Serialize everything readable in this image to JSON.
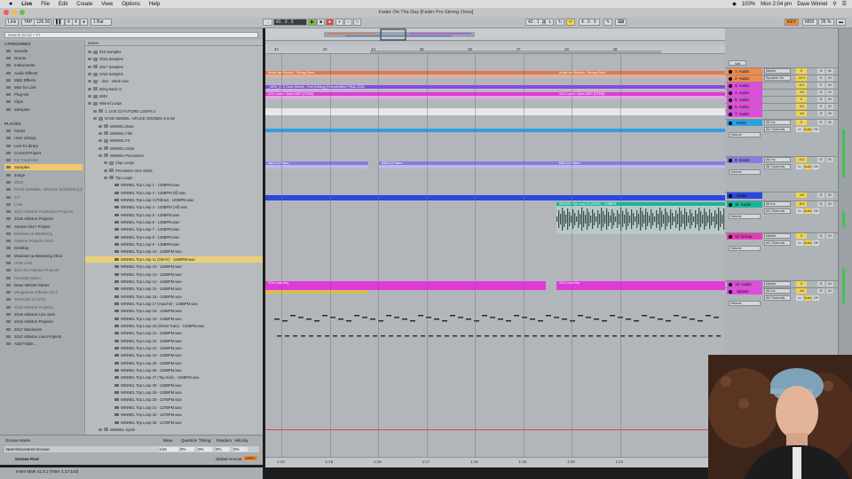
{
  "menubar": {
    "apple": "",
    "app": "Live",
    "items": [
      "File",
      "Edit",
      "Create",
      "View",
      "Options",
      "Help"
    ],
    "battery": "100%",
    "clock": "Mon 2:04 pm",
    "user": "Dave Winnel"
  },
  "window": {
    "title": "Fader On The Day  [Fader Pro Strong Ones]"
  },
  "transport": {
    "link": "Link",
    "tap": "TAP",
    "tempo": "126.00",
    "sig_num": "4",
    "sig_den": "4",
    "metro": "1 Bar",
    "pos": "41 . 3 . 3",
    "loop_start": "42 . 1 . 1",
    "loop_len": "4 . 0 . 0",
    "key": "KEY",
    "midi": "MIDI",
    "cpu": "26 %"
  },
  "browser": {
    "search_placeholder": "Search (Cmd + F)",
    "categories_title": "CATEGORIES",
    "categories": [
      "Sounds",
      "Drums",
      "Instruments",
      "Audio Effects",
      "MIDI Effects",
      "Max for Live",
      "Plug-ins",
      "Clips",
      "Samples"
    ],
    "places_title": "PLACES",
    "places": [
      {
        "label": "Packs",
        "dim": false
      },
      {
        "label": "User Library",
        "dim": false
      },
      {
        "label": "Live 9 Library",
        "dim": false
      },
      {
        "label": "Current Project",
        "dim": false
      },
      {
        "label": "KS Tonal Hits",
        "dim": true
      },
      {
        "label": "Samples",
        "dim": false,
        "sel": true
      },
      {
        "label": "songs",
        "dim": false
      },
      {
        "label": "2013",
        "dim": true
      },
      {
        "label": "DAVE WINNEL -SPLICE SOUNDS (cla",
        "dim": true
      },
      {
        "label": "S.F",
        "dim": true
      },
      {
        "label": "LAM",
        "dim": true
      },
      {
        "label": "2013 Ableton Production Projects",
        "dim": true
      },
      {
        "label": "2015 Ableton Projects",
        "dim": false
      },
      {
        "label": "Axtone 2017 Project",
        "dim": false
      },
      {
        "label": "Mixdown & Mastering",
        "dim": true
      },
      {
        "label": "Ableton Projects 2014",
        "dim": true
      },
      {
        "label": "Desktop",
        "dim": false
      },
      {
        "label": "Mixdown & Mastering 2014",
        "dim": false
      },
      {
        "label": "UGB JAM",
        "dim": true
      },
      {
        "label": "2014 DJ Ableton Projects",
        "dim": true
      },
      {
        "label": "Recently taken",
        "dim": true
      },
      {
        "label": "Dave Winnel Stems",
        "dim": false
      },
      {
        "label": "Vengeance Effects Vol 3",
        "dim": true
      },
      {
        "label": "TomKOD DJ DTS",
        "dim": true
      },
      {
        "label": "2016 Ableton Projects",
        "dim": true
      },
      {
        "label": "2016 Ableton Live Sets",
        "dim": false
      },
      {
        "label": "2016 Ableton Projects",
        "dim": false
      },
      {
        "label": "2017 Mixdowns",
        "dim": false
      },
      {
        "label": "2017 Ableton Live Projects",
        "dim": false
      },
      {
        "label": "Add Folder...",
        "dim": false
      }
    ],
    "files_header": "Name",
    "files": [
      {
        "label": "015 Samples",
        "lvl": 0,
        "k": "f"
      },
      {
        "label": "2016 Samples",
        "lvl": 0,
        "k": "f"
      },
      {
        "label": "2017 Samples",
        "lvl": 0,
        "k": "f"
      },
      {
        "label": "2018 Samples",
        "lvl": 0,
        "k": "f"
      },
      {
        "label": "- devi - ostek new",
        "lvl": 0,
        "k": "f"
      },
      {
        "label": "Bring Back In",
        "lvl": 0,
        "k": "f"
      },
      {
        "label": "MIDI",
        "lvl": 0,
        "k": "f"
      },
      {
        "label": "Winnel Loops",
        "lvl": 0,
        "k": "o"
      },
      {
        "label": "1. LIVE DJ FUTURE LOOPS 2",
        "lvl": 1,
        "k": "f"
      },
      {
        "label": "DAVE WINNEL -SPLICE SOUNDS S-5-18",
        "lvl": 1,
        "k": "o"
      },
      {
        "label": "WINNEL Bass",
        "lvl": 2,
        "k": "f"
      },
      {
        "label": "WINNEL Fills",
        "lvl": 2,
        "k": "f"
      },
      {
        "label": "WINNEL FX",
        "lvl": 2,
        "k": "f"
      },
      {
        "label": "WINNEL Kicks",
        "lvl": 2,
        "k": "f"
      },
      {
        "label": "WINNEL Percussion",
        "lvl": 2,
        "k": "o"
      },
      {
        "label": "Clap Loops",
        "lvl": 3,
        "k": "f"
      },
      {
        "label": "Percussion One Shots",
        "lvl": 3,
        "k": "f"
      },
      {
        "label": "Top Loops",
        "lvl": 3,
        "k": "o"
      },
      {
        "label": "WINNEL Top Loop 1 - 126BPM.wav",
        "lvl": 4,
        "k": "w"
      },
      {
        "label": "WINNEL Top Loop 2 - 126BPM (Ill).wav",
        "lvl": 4,
        "k": "w"
      },
      {
        "label": "WINNEL Top Loop 3 (Follow) - 126BPM.wav",
        "lvl": 4,
        "k": "w"
      },
      {
        "label": "WINNEL Top Loop 4 - 126BPM (All).wav",
        "lvl": 4,
        "k": "w"
      },
      {
        "label": "WINNEL Top Loop 5 - 126BPM.wav",
        "lvl": 4,
        "k": "w"
      },
      {
        "label": "WINNEL Top Loop 6 - 126BPM.wav",
        "lvl": 4,
        "k": "w"
      },
      {
        "label": "WINNEL Top Loop 7 - 126BPM.wav",
        "lvl": 4,
        "k": "w"
      },
      {
        "label": "WINNEL Top Loop 8 - 126BPM.wav",
        "lvl": 4,
        "k": "w"
      },
      {
        "label": "WINNEL Top Loop 9 - 126BPM.wav",
        "lvl": 4,
        "k": "w"
      },
      {
        "label": "WINNEL Top Loop 10 - 126BPM.wav",
        "lvl": 4,
        "k": "w"
      },
      {
        "label": "WINNEL Top Loop 11 (OKAY) - 126BPM.wav",
        "lvl": 4,
        "k": "w",
        "sel": true
      },
      {
        "label": "WINNEL Top Loop 12 - 126BPM.wav",
        "lvl": 4,
        "k": "w"
      },
      {
        "label": "WINNEL Top Loop 13 - 126BPM.wav",
        "lvl": 4,
        "k": "w"
      },
      {
        "label": "WINNEL Top Loop 14 - 126BPM.wav",
        "lvl": 4,
        "k": "w"
      },
      {
        "label": "WINNEL Top Loop 15 - 126BPM.wav",
        "lvl": 4,
        "k": "w"
      },
      {
        "label": "WINNEL Top Loop 16 - 126BPM.wav",
        "lvl": 4,
        "k": "w"
      },
      {
        "label": "WINNEL Top Loop 17 (Apache) - 126BPM.wav",
        "lvl": 4,
        "k": "w"
      },
      {
        "label": "WINNEL Top Loop 18 - 126BPM.wav",
        "lvl": 4,
        "k": "w"
      },
      {
        "label": "WINNEL Top Loop 19 - 126BPM.wav",
        "lvl": 4,
        "k": "w"
      },
      {
        "label": "WINNEL Top Loop 20 (Ghost Train) - 126BPM.wav",
        "lvl": 4,
        "k": "w"
      },
      {
        "label": "WINNEL Top Loop 21 - 126BPM.wav",
        "lvl": 4,
        "k": "w"
      },
      {
        "label": "WINNEL Top Loop 22 - 126BPM.wav",
        "lvl": 4,
        "k": "w"
      },
      {
        "label": "WINNEL Top Loop 23 - 126BPM.wav",
        "lvl": 4,
        "k": "w"
      },
      {
        "label": "WINNEL Top Loop 24 - 126BPM.wav",
        "lvl": 4,
        "k": "w"
      },
      {
        "label": "WINNEL Top Loop 25 - 126BPM.wav",
        "lvl": 4,
        "k": "w"
      },
      {
        "label": "WINNEL Top Loop 26 - 126BPM.wav",
        "lvl": 4,
        "k": "w"
      },
      {
        "label": "WINNEL Top Loop 27 (Top Kick) - 126BPM.wav",
        "lvl": 4,
        "k": "w"
      },
      {
        "label": "WINNEL Top Loop 28 - 126BPM.wav",
        "lvl": 4,
        "k": "w"
      },
      {
        "label": "WINNEL Top Loop 29 - 126BPM.wav",
        "lvl": 4,
        "k": "w"
      },
      {
        "label": "WINNEL Top Loop 30 - 127BPM.wav",
        "lvl": 4,
        "k": "w"
      },
      {
        "label": "WINNEL Top Loop 31 - 127BPM.wav",
        "lvl": 4,
        "k": "w"
      },
      {
        "label": "WINNEL Top Loop 32 - 127BPM.wav",
        "lvl": 4,
        "k": "w"
      },
      {
        "label": "WINNEL Top Loop 33 - 127BPM.wav",
        "lvl": 4,
        "k": "w"
      },
      {
        "label": "WINNEL Synth",
        "lvl": 2,
        "k": "f"
      }
    ]
  },
  "groove": {
    "cols": [
      "Groove Name",
      "Base",
      "Quantize",
      "Timing",
      "Random",
      "Velocity"
    ],
    "row": "New Discovered Groove",
    "base": "1/16",
    "q": "0%",
    "t": "0%",
    "r": "0%",
    "v": "0%",
    "pool": "Groove Pool",
    "amount_label": "Global Amount",
    "amount": "100%"
  },
  "statusbar": "Insert Mark 41.3.1 (Time: 1:17:143)",
  "ruler": {
    "top": [
      "42",
      "43",
      "44",
      "45",
      "46",
      "47",
      "48",
      "49"
    ],
    "bottom": [
      "1:14",
      "1:15",
      "1:16",
      "1:17",
      "1:18",
      "1:19",
      "1:20",
      "1:21"
    ]
  },
  "clips": {
    "c1": "Armin van Buuren - Strong Ones",
    "c1b": "Armin van Buuren - Strong Ones",
    "c2": "_NEW_ID & Dave Winnel - Feel Nothing (ExtendedMix) FINAL 2018",
    "c3": "VOX Lead + Dubs WET (STEM)",
    "c3b": "VOX Lead + Dubs WET (STEM)",
    "c4a": "MIDI LD Piano",
    "c4b": "MIDI LD Piano",
    "c4c": "MIDI LD Piano",
    "c5": "WINNEL Top Loop 11 (OKAY) - 126BPM",
    "c6a": "VOX Lead Dry",
    "c6b": "VOX Lead Dry"
  },
  "mixer": {
    "tracks": [
      {
        "num": "1",
        "name": "Audio",
        "color": "#f08a4b",
        "io": "Master"
      },
      {
        "num": "2",
        "name": "Audio",
        "color": "#f08a4b",
        "io": "Speaker On"
      },
      {
        "num": "3",
        "name": "Audio",
        "color": "#e24ae0",
        "io": ""
      },
      {
        "num": "4",
        "name": "Audio",
        "color": "#e24ae0",
        "io": ""
      },
      {
        "num": "5",
        "name": "Audio",
        "color": "#e24ae0",
        "io": ""
      },
      {
        "num": "6",
        "name": "Audio",
        "color": "#e24ae0",
        "io": ""
      },
      {
        "num": "7",
        "name": "Audio",
        "color": "#e24ae0",
        "io": ""
      },
      {
        "num": "",
        "name": "Kicks",
        "color": "#2f9fe0",
        "io": "All Ins"
      },
      {
        "num": "8",
        "name": "Snare",
        "color": "#8a7be0",
        "io": "All Ins"
      },
      {
        "num": "",
        "name": "Claps",
        "color": "#2a48e0",
        "io": ""
      },
      {
        "num": "11",
        "name": "Audio",
        "color": "#19b59a",
        "io": "All Ins"
      },
      {
        "num": "12",
        "name": "Group",
        "color": "#e83ab6",
        "io": "Master"
      },
      {
        "num": "13",
        "name": "Audio",
        "color": "#e24ae0",
        "io": "Master"
      },
      {
        "num": "",
        "name": "Splash",
        "color": "#e24ae0",
        "io": "All Ins"
      }
    ],
    "returns": [
      {
        "name": "A Reverb",
        "color": "#e0463c"
      },
      {
        "name": "B Delay",
        "color": "#e0463c"
      }
    ],
    "master": "Master",
    "master_io": "1/10",
    "labels": {
      "in": "All Ins",
      "ch": "All Channels",
      "mon1": "In",
      "mon2": "Auto",
      "mon3": "Off",
      "kick_route": "Kick Route FX",
      "volume": "Volume",
      "track_vol": "Track Volume",
      "group": "Group",
      "mixer": "Mixer",
      "reverb": "A-Reverb",
      "drywet": "Dry/Wet",
      "s": "S",
      "m": "M"
    },
    "vals": [
      "0",
      "-12.9",
      "-6.0",
      "-inf",
      "0",
      "-3.0",
      "-inf",
      "0",
      "-6.0",
      "-inf",
      "-8.9",
      "0",
      "0",
      "-inf"
    ]
  }
}
